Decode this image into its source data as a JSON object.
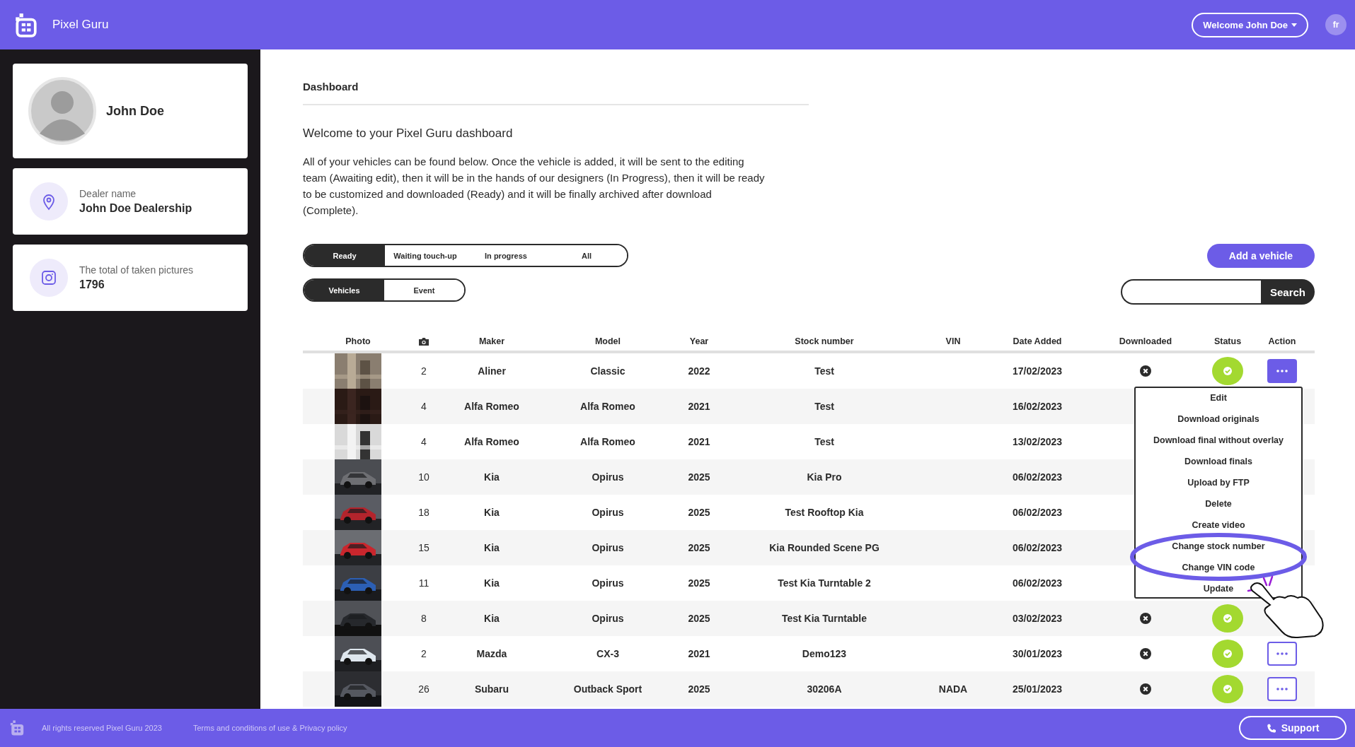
{
  "header": {
    "brand": "Pixel Guru",
    "user_button": "Welcome John Doe",
    "language": "fr"
  },
  "sidebar": {
    "profile": {
      "name": "John Doe"
    },
    "cards": [
      {
        "kind": "location",
        "label": "Dealer name",
        "value": "John Doe Dealership"
      },
      {
        "kind": "camera",
        "label": "The total of taken pictures",
        "value": "1796"
      }
    ]
  },
  "page": {
    "title": "Dashboard",
    "heading": "Welcome to your Pixel Guru dashboard",
    "intro": "All of your vehicles can be found below. Once the vehicle is added, it will be sent to the editing team (Awaiting edit), then it will be in the hands of our designers (In Progress), then it will be ready to be customized and downloaded (Ready) and it will be finally archived after download (Complete)."
  },
  "status_tabs": [
    {
      "label": "Ready",
      "selected": true
    },
    {
      "label": "Waiting touch-up",
      "selected": false
    },
    {
      "label": "In progress",
      "selected": false
    },
    {
      "label": "All",
      "selected": false
    }
  ],
  "type_tabs": [
    {
      "label": "Vehicles",
      "selected": true
    },
    {
      "label": "Event",
      "selected": false
    }
  ],
  "add_button": "Add a vehicle",
  "search": {
    "button": "Search"
  },
  "table": {
    "columns": [
      {
        "kind": "text",
        "label": "Photo"
      },
      {
        "kind": "camera"
      },
      {
        "kind": "text",
        "label": "Maker"
      },
      {
        "kind": "text",
        "label": "Model"
      },
      {
        "kind": "text",
        "label": "Year"
      },
      {
        "kind": "text",
        "label": "Stock number"
      },
      {
        "kind": "text",
        "label": "VIN"
      },
      {
        "kind": "text",
        "label": "Date Added"
      },
      {
        "kind": "text",
        "label": "Downloaded"
      },
      {
        "kind": "text",
        "label": "Status"
      },
      {
        "kind": "text",
        "label": "Action"
      }
    ],
    "rows": [
      {
        "photos": "2",
        "maker": "Aliner",
        "model": "Classic",
        "year": "2022",
        "stock": "Test",
        "date": "17/02/2023",
        "downloaded": false,
        "ready": true,
        "action": {
          "open": true
        }
      },
      {
        "photos": "4",
        "maker": "Alfa Romeo",
        "model": "Alfa Romeo",
        "year": "2021",
        "stock": "Test",
        "date": "16/02/2023"
      },
      {
        "photos": "4",
        "maker": "Alfa Romeo",
        "model": "Alfa Romeo",
        "year": "2021",
        "stock": "Test",
        "date": "13/02/2023"
      },
      {
        "photos": "10",
        "maker": "Kia",
        "model": "Opirus",
        "year": "2025",
        "stock": "Kia Pro",
        "date": "06/02/2023"
      },
      {
        "photos": "18",
        "maker": "Kia",
        "model": "Opirus",
        "year": "2025",
        "stock": "Test Rooftop Kia",
        "date": "06/02/2023"
      },
      {
        "photos": "15",
        "maker": "Kia",
        "model": "Opirus",
        "year": "2025",
        "stock": "Kia Rounded Scene PG",
        "date": "06/02/2023"
      },
      {
        "photos": "11",
        "maker": "Kia",
        "model": "Opirus",
        "year": "2025",
        "stock": "Test Kia Turntable 2",
        "date": "06/02/2023"
      },
      {
        "photos": "8",
        "maker": "Kia",
        "model": "Opirus",
        "year": "2025",
        "stock": "Test Kia Turntable",
        "date": "03/02/2023",
        "downloaded": false,
        "ready": true
      },
      {
        "photos": "2",
        "maker": "Mazda",
        "model": "CX-3",
        "year": "2021",
        "stock": "Demo123",
        "date": "30/01/2023",
        "downloaded": false,
        "ready": true,
        "action": {
          "open": false
        }
      },
      {
        "photos": "26",
        "maker": "Subaru",
        "model": "Outback Sport",
        "year": "2025",
        "stock": "30206A",
        "vin": "NADA",
        "date": "25/01/2023",
        "downloaded": false,
        "ready": true,
        "action": {
          "open": false
        }
      }
    ]
  },
  "action_menu": [
    "Edit",
    "Download originals",
    "Download final without overlay",
    "Download finals",
    "Upload by FTP",
    "Delete",
    "Create video",
    "Change stock number",
    "Change VIN code",
    "Update"
  ],
  "footer": {
    "copyright": "All rights reserved Pixel Guru 2023",
    "links": "Terms and conditions of use & Privacy policy",
    "support": "Support"
  }
}
